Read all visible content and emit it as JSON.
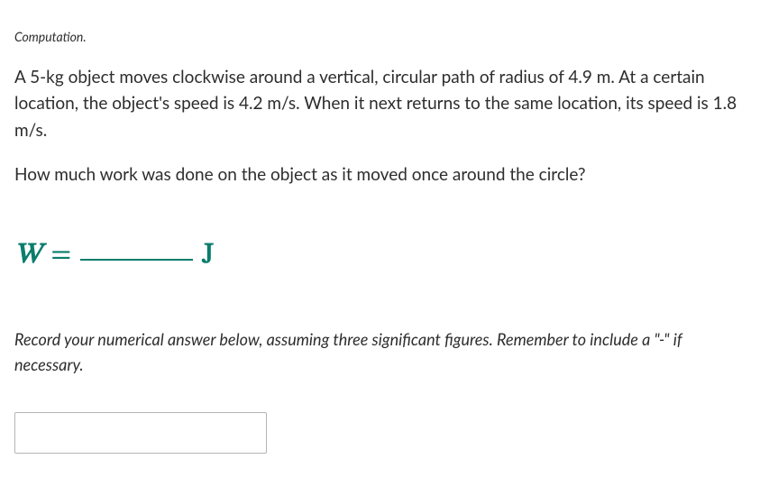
{
  "label": "Computation.",
  "problem": "A 5-kg object moves clockwise around a vertical, circular path of radius of 4.9 m. At a certain location, the object's speed is 4.2 m/s. When it next returns to the same location, its speed is 1.8 m/s.",
  "question": "How much work was done on the object as it moved once around the circle?",
  "equation": {
    "variable": "W",
    "equals": "=",
    "blank": "",
    "unit": "J"
  },
  "instructions": "Record your numerical answer below, assuming three significant figures. Remember to include a \"-\" if necessary.",
  "answer_value": "",
  "answer_placeholder": ""
}
